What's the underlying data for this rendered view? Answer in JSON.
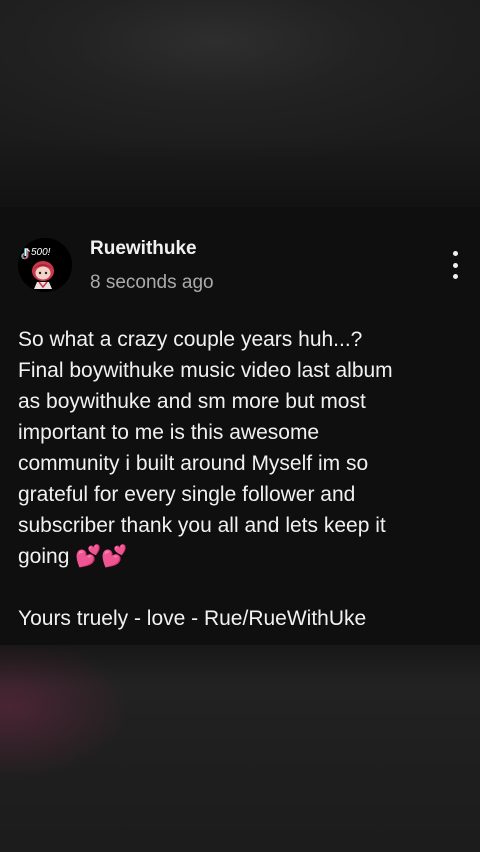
{
  "post": {
    "author": "Ruewithuke",
    "timestamp": "8 seconds ago",
    "avatar_badge": "500!",
    "menu_icon": "more-vertical-icon",
    "body_lines": [
      "So what a crazy couple years huh...?",
      "Final boywithuke music video last album",
      "as boywithuke and sm more but most",
      "important to me is this awesome",
      "community i built around Myself im so",
      "grateful for every single follower and",
      "subscriber thank you all and lets keep it",
      "going 💕💕"
    ],
    "signature": "Yours truely - love - Rue/RueWithUke"
  },
  "colors": {
    "card_background": "#0f0f0f",
    "author_text": "#f1f1f1",
    "timestamp_text": "#aaaaaa",
    "body_text": "#f1f1f1"
  }
}
